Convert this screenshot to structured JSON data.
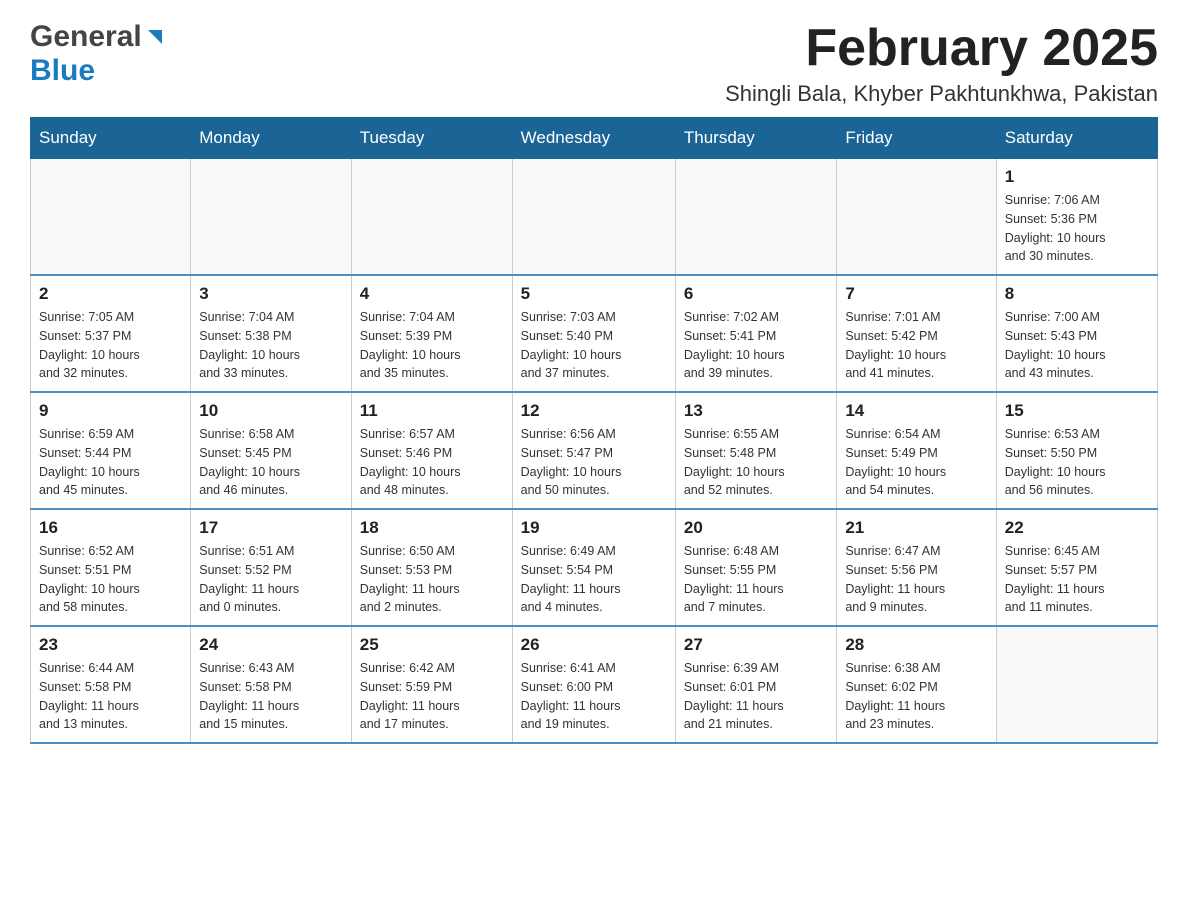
{
  "header": {
    "logo": {
      "general_text": "General",
      "blue_text": "Blue"
    },
    "title": "February 2025",
    "location": "Shingli Bala, Khyber Pakhtunkhwa, Pakistan"
  },
  "calendar": {
    "days_of_week": [
      "Sunday",
      "Monday",
      "Tuesday",
      "Wednesday",
      "Thursday",
      "Friday",
      "Saturday"
    ],
    "weeks": [
      [
        {
          "day": "",
          "info": ""
        },
        {
          "day": "",
          "info": ""
        },
        {
          "day": "",
          "info": ""
        },
        {
          "day": "",
          "info": ""
        },
        {
          "day": "",
          "info": ""
        },
        {
          "day": "",
          "info": ""
        },
        {
          "day": "1",
          "info": "Sunrise: 7:06 AM\nSunset: 5:36 PM\nDaylight: 10 hours\nand 30 minutes."
        }
      ],
      [
        {
          "day": "2",
          "info": "Sunrise: 7:05 AM\nSunset: 5:37 PM\nDaylight: 10 hours\nand 32 minutes."
        },
        {
          "day": "3",
          "info": "Sunrise: 7:04 AM\nSunset: 5:38 PM\nDaylight: 10 hours\nand 33 minutes."
        },
        {
          "day": "4",
          "info": "Sunrise: 7:04 AM\nSunset: 5:39 PM\nDaylight: 10 hours\nand 35 minutes."
        },
        {
          "day": "5",
          "info": "Sunrise: 7:03 AM\nSunset: 5:40 PM\nDaylight: 10 hours\nand 37 minutes."
        },
        {
          "day": "6",
          "info": "Sunrise: 7:02 AM\nSunset: 5:41 PM\nDaylight: 10 hours\nand 39 minutes."
        },
        {
          "day": "7",
          "info": "Sunrise: 7:01 AM\nSunset: 5:42 PM\nDaylight: 10 hours\nand 41 minutes."
        },
        {
          "day": "8",
          "info": "Sunrise: 7:00 AM\nSunset: 5:43 PM\nDaylight: 10 hours\nand 43 minutes."
        }
      ],
      [
        {
          "day": "9",
          "info": "Sunrise: 6:59 AM\nSunset: 5:44 PM\nDaylight: 10 hours\nand 45 minutes."
        },
        {
          "day": "10",
          "info": "Sunrise: 6:58 AM\nSunset: 5:45 PM\nDaylight: 10 hours\nand 46 minutes."
        },
        {
          "day": "11",
          "info": "Sunrise: 6:57 AM\nSunset: 5:46 PM\nDaylight: 10 hours\nand 48 minutes."
        },
        {
          "day": "12",
          "info": "Sunrise: 6:56 AM\nSunset: 5:47 PM\nDaylight: 10 hours\nand 50 minutes."
        },
        {
          "day": "13",
          "info": "Sunrise: 6:55 AM\nSunset: 5:48 PM\nDaylight: 10 hours\nand 52 minutes."
        },
        {
          "day": "14",
          "info": "Sunrise: 6:54 AM\nSunset: 5:49 PM\nDaylight: 10 hours\nand 54 minutes."
        },
        {
          "day": "15",
          "info": "Sunrise: 6:53 AM\nSunset: 5:50 PM\nDaylight: 10 hours\nand 56 minutes."
        }
      ],
      [
        {
          "day": "16",
          "info": "Sunrise: 6:52 AM\nSunset: 5:51 PM\nDaylight: 10 hours\nand 58 minutes."
        },
        {
          "day": "17",
          "info": "Sunrise: 6:51 AM\nSunset: 5:52 PM\nDaylight: 11 hours\nand 0 minutes."
        },
        {
          "day": "18",
          "info": "Sunrise: 6:50 AM\nSunset: 5:53 PM\nDaylight: 11 hours\nand 2 minutes."
        },
        {
          "day": "19",
          "info": "Sunrise: 6:49 AM\nSunset: 5:54 PM\nDaylight: 11 hours\nand 4 minutes."
        },
        {
          "day": "20",
          "info": "Sunrise: 6:48 AM\nSunset: 5:55 PM\nDaylight: 11 hours\nand 7 minutes."
        },
        {
          "day": "21",
          "info": "Sunrise: 6:47 AM\nSunset: 5:56 PM\nDaylight: 11 hours\nand 9 minutes."
        },
        {
          "day": "22",
          "info": "Sunrise: 6:45 AM\nSunset: 5:57 PM\nDaylight: 11 hours\nand 11 minutes."
        }
      ],
      [
        {
          "day": "23",
          "info": "Sunrise: 6:44 AM\nSunset: 5:58 PM\nDaylight: 11 hours\nand 13 minutes."
        },
        {
          "day": "24",
          "info": "Sunrise: 6:43 AM\nSunset: 5:58 PM\nDaylight: 11 hours\nand 15 minutes."
        },
        {
          "day": "25",
          "info": "Sunrise: 6:42 AM\nSunset: 5:59 PM\nDaylight: 11 hours\nand 17 minutes."
        },
        {
          "day": "26",
          "info": "Sunrise: 6:41 AM\nSunset: 6:00 PM\nDaylight: 11 hours\nand 19 minutes."
        },
        {
          "day": "27",
          "info": "Sunrise: 6:39 AM\nSunset: 6:01 PM\nDaylight: 11 hours\nand 21 minutes."
        },
        {
          "day": "28",
          "info": "Sunrise: 6:38 AM\nSunset: 6:02 PM\nDaylight: 11 hours\nand 23 minutes."
        },
        {
          "day": "",
          "info": ""
        }
      ]
    ]
  }
}
